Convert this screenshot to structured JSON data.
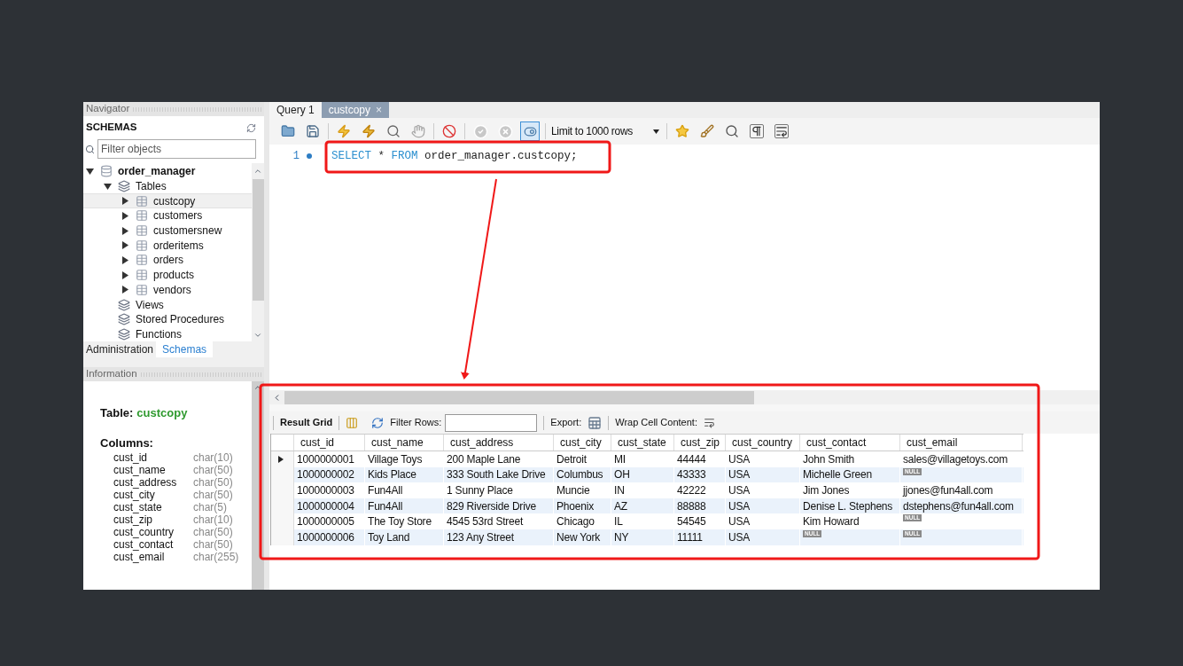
{
  "navigator": {
    "title": "Navigator",
    "schemas_label": "SCHEMAS",
    "filter": {
      "placeholder": "Filter objects"
    },
    "tree": [
      {
        "label": "order_manager",
        "kind": "schema",
        "expanded": true,
        "selected": false,
        "children": [
          {
            "label": "Tables",
            "kind": "folder",
            "expanded": true,
            "selected": false,
            "children": [
              {
                "label": "custcopy",
                "kind": "table",
                "expanded": false,
                "selected": true
              },
              {
                "label": "customers",
                "kind": "table",
                "expanded": false,
                "selected": false
              },
              {
                "label": "customersnew",
                "kind": "table",
                "expanded": false,
                "selected": false
              },
              {
                "label": "orderitems",
                "kind": "table",
                "expanded": false,
                "selected": false
              },
              {
                "label": "orders",
                "kind": "table",
                "expanded": false,
                "selected": false
              },
              {
                "label": "products",
                "kind": "table",
                "expanded": false,
                "selected": false
              },
              {
                "label": "vendors",
                "kind": "table",
                "expanded": false,
                "selected": false
              }
            ]
          },
          {
            "label": "Views",
            "kind": "folder",
            "selected": false
          },
          {
            "label": "Stored Procedures",
            "kind": "folder",
            "selected": false
          },
          {
            "label": "Functions",
            "kind": "folder",
            "selected": false
          }
        ]
      }
    ],
    "tabs": [
      {
        "label": "Administration",
        "selected": false
      },
      {
        "label": "Schemas",
        "selected": true
      }
    ]
  },
  "information": {
    "title": "Information",
    "table_label": "Table:",
    "table_name": "custcopy",
    "columns_label": "Columns:",
    "columns": [
      {
        "name": "cust_id",
        "type": "char(10)"
      },
      {
        "name": "cust_name",
        "type": "char(50)"
      },
      {
        "name": "cust_address",
        "type": "char(50)"
      },
      {
        "name": "cust_city",
        "type": "char(50)"
      },
      {
        "name": "cust_state",
        "type": "char(5)"
      },
      {
        "name": "cust_zip",
        "type": "char(10)"
      },
      {
        "name": "cust_country",
        "type": "char(50)"
      },
      {
        "name": "cust_contact",
        "type": "char(50)"
      },
      {
        "name": "cust_email",
        "type": "char(255)"
      }
    ]
  },
  "editor": {
    "tabs": [
      {
        "label": "Query 1",
        "selected": true,
        "closable": false
      },
      {
        "label": "custcopy",
        "selected": false,
        "closable": true,
        "close": "×"
      }
    ],
    "limit": "Limit to 1000 rows",
    "lines": [
      {
        "number": "1",
        "tokens": [
          {
            "text": "SELECT",
            "kind": "keyword"
          },
          {
            "text": " * ",
            "kind": "plain"
          },
          {
            "text": "FROM",
            "kind": "keyword"
          },
          {
            "text": " order_manager.custcopy;",
            "kind": "plain"
          }
        ]
      }
    ]
  },
  "results": {
    "result_grid": "Result Grid",
    "filter_label": "Filter Rows:",
    "export_label": "Export:",
    "wrap_label": "Wrap Cell Content:",
    "columns": [
      "cust_id",
      "cust_name",
      "cust_address",
      "cust_city",
      "cust_state",
      "cust_zip",
      "cust_country",
      "cust_contact",
      "cust_email"
    ],
    "rows": [
      {
        "selected": true,
        "cells": [
          "1000000001",
          "Village Toys",
          "200 Maple Lane",
          "Detroit",
          "MI",
          "44444",
          "USA",
          "John Smith",
          "sales@villagetoys.com"
        ]
      },
      {
        "selected": false,
        "cells": [
          "1000000002",
          "Kids Place",
          "333 South Lake Drive",
          "Columbus",
          "OH",
          "43333",
          "USA",
          "Michelle Green",
          {
            "text": "NULL",
            "kind": "null"
          }
        ]
      },
      {
        "selected": false,
        "cells": [
          "1000000003",
          "Fun4All",
          "1 Sunny Place",
          "Muncie",
          "IN",
          "42222",
          "USA",
          "Jim Jones",
          "jjones@fun4all.com"
        ]
      },
      {
        "selected": false,
        "cells": [
          "1000000004",
          "Fun4All",
          "829 Riverside Drive",
          "Phoenix",
          "AZ",
          "88888",
          "USA",
          "Denise L. Stephens",
          "dstephens@fun4all.com"
        ]
      },
      {
        "selected": false,
        "cells": [
          "1000000005",
          "The Toy Store",
          "4545 53rd Street",
          "Chicago",
          "IL",
          "54545",
          "USA",
          "Kim Howard",
          {
            "text": "NULL",
            "kind": "null"
          }
        ]
      },
      {
        "selected": false,
        "cells": [
          "1000000006",
          "Toy Land",
          "123 Any Street",
          "New York",
          "NY",
          "11111",
          "USA",
          {
            "text": "NULL",
            "kind": "null"
          },
          {
            "text": "NULL",
            "kind": "null"
          }
        ]
      }
    ]
  }
}
